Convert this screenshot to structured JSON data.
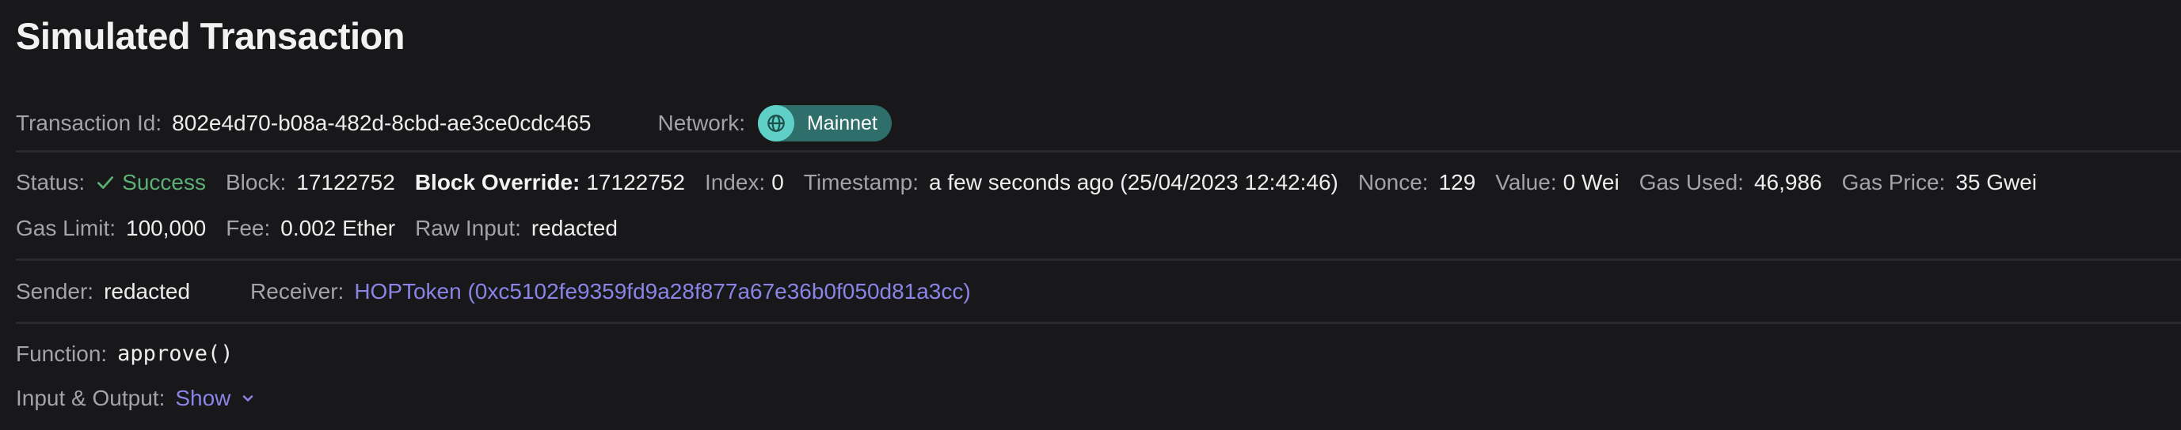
{
  "title": "Simulated Transaction",
  "transaction": {
    "id_label": "Transaction Id:",
    "id_value": "802e4d70-b08a-482d-8cbd-ae3ce0cdc465",
    "network_label": "Network:",
    "network_value": "Mainnet"
  },
  "details": {
    "status_label": "Status:",
    "status_value": "Success",
    "block_label": "Block:",
    "block_value": "17122752",
    "block_override_label": "Block Override:",
    "block_override_value": "17122752",
    "index_label": "Index:",
    "index_value": "0",
    "timestamp_label": "Timestamp:",
    "timestamp_value": "a few seconds ago (25/04/2023 12:42:46)",
    "nonce_label": "Nonce:",
    "nonce_value": "129",
    "value_label": "Value:",
    "value_value": "0 Wei",
    "gas_used_label": "Gas Used:",
    "gas_used_value": "46,986",
    "gas_price_label": "Gas Price:",
    "gas_price_value": "35 Gwei",
    "gas_limit_label": "Gas Limit:",
    "gas_limit_value": "100,000",
    "fee_label": "Fee:",
    "fee_value": "0.002 Ether",
    "raw_input_label": "Raw Input:",
    "raw_input_value": "redacted"
  },
  "parties": {
    "sender_label": "Sender:",
    "sender_value": "redacted",
    "receiver_label": "Receiver:",
    "receiver_value": "HOPToken (0xc5102fe9359fd9a28f877a67e36b0f050d81a3cc)"
  },
  "function": {
    "function_label": "Function:",
    "function_value": "approve()",
    "io_label": "Input & Output:",
    "io_toggle": "Show"
  },
  "icons": {
    "status": "check-icon",
    "network": "globe-icon",
    "toggle": "chevron-down-icon"
  },
  "colors": {
    "background": "#18181b",
    "success": "#5db075",
    "link": "#8b84e6",
    "network_pill": "#2f6f6b",
    "network_icon_bg": "#5fd0c7"
  }
}
